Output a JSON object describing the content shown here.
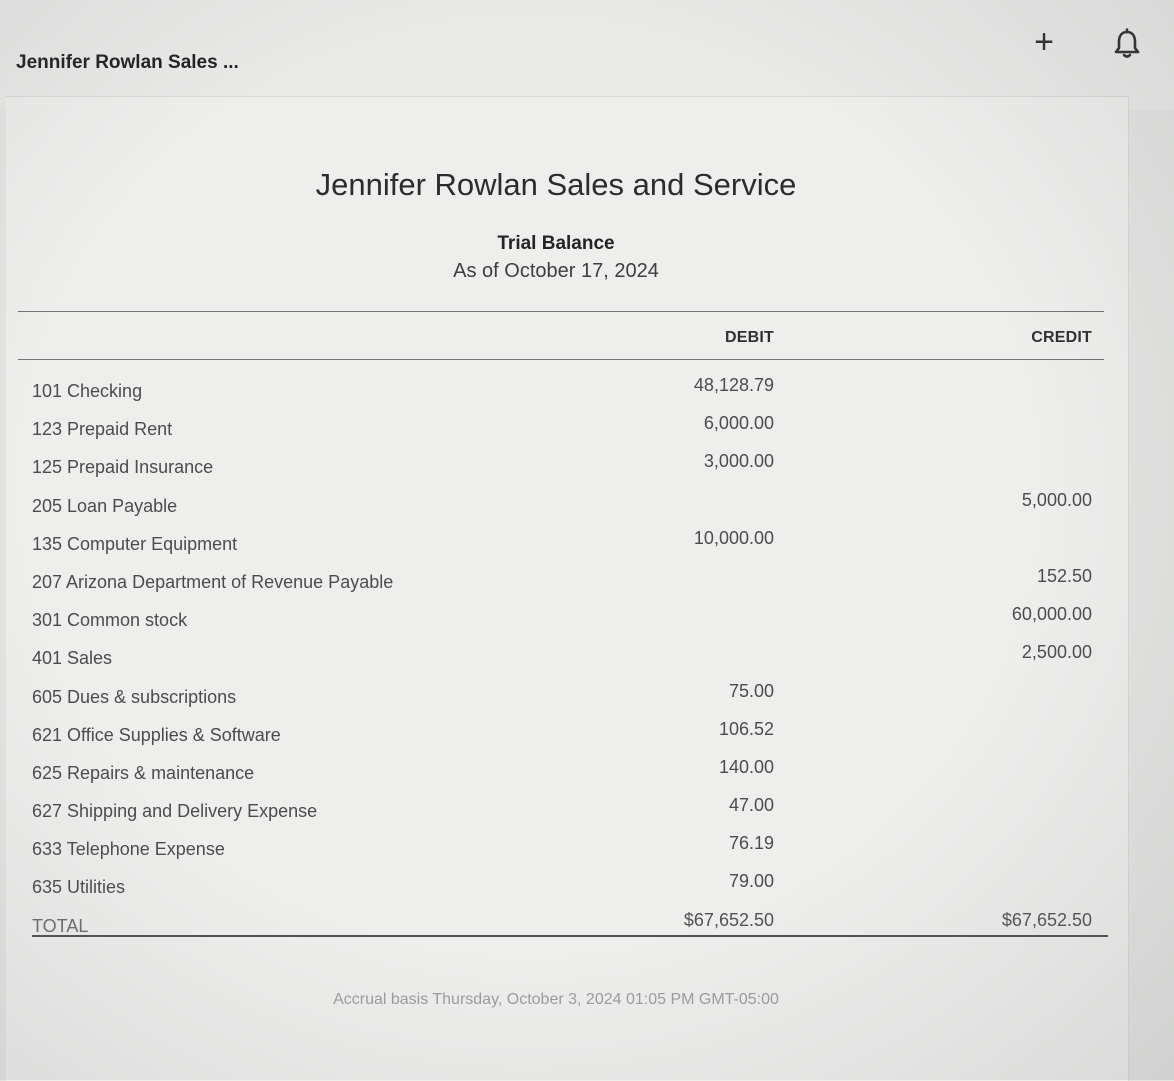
{
  "header": {
    "company_short": "Jennifer Rowlan Sales ...",
    "plus_symbol": "+",
    "icons": {
      "add": "plus-icon",
      "notifications": "bell-icon"
    }
  },
  "report": {
    "company": "Jennifer Rowlan Sales and Service",
    "title": "Trial Balance",
    "date": "As of October 17, 2024",
    "columns": {
      "debit": "DEBIT",
      "credit": "CREDIT"
    },
    "rows": [
      {
        "account": "101 Checking",
        "debit": "48,128.79",
        "credit": ""
      },
      {
        "account": "123 Prepaid Rent",
        "debit": "6,000.00",
        "credit": ""
      },
      {
        "account": "125 Prepaid Insurance",
        "debit": "3,000.00",
        "credit": ""
      },
      {
        "account": "205 Loan Payable",
        "debit": "",
        "credit": "5,000.00"
      },
      {
        "account": "135 Computer Equipment",
        "debit": "10,000.00",
        "credit": ""
      },
      {
        "account": "207 Arizona Department of Revenue Payable",
        "debit": "",
        "credit": "152.50"
      },
      {
        "account": "301 Common stock",
        "debit": "",
        "credit": "60,000.00"
      },
      {
        "account": "401 Sales",
        "debit": "",
        "credit": "2,500.00"
      },
      {
        "account": "605 Dues & subscriptions",
        "debit": "75.00",
        "credit": ""
      },
      {
        "account": "621 Office Supplies & Software",
        "debit": "106.52",
        "credit": ""
      },
      {
        "account": "625 Repairs & maintenance",
        "debit": "140.00",
        "credit": ""
      },
      {
        "account": "627 Shipping and Delivery Expense",
        "debit": "47.00",
        "credit": ""
      },
      {
        "account": "633 Telephone Expense",
        "debit": "76.19",
        "credit": ""
      },
      {
        "account": "635 Utilities",
        "debit": "79.00",
        "credit": ""
      }
    ],
    "total": {
      "label": "TOTAL",
      "debit": "$67,652.50",
      "credit": "$67,652.50"
    },
    "footer": "Accrual basis Thursday, October 3, 2024 01:05 PM GMT-05:00"
  },
  "colors": {
    "background": "#e4e5e3",
    "report_background": "#eeefed",
    "text_dark": "#2a2c2e",
    "text_muted": "#4a4c4e"
  }
}
